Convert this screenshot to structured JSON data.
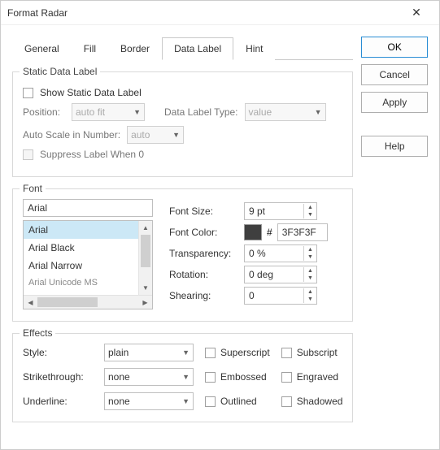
{
  "window": {
    "title": "Format Radar"
  },
  "tabs": [
    "General",
    "Fill",
    "Border",
    "Data Label",
    "Hint"
  ],
  "active_tab": "Data Label",
  "buttons": {
    "ok": "OK",
    "cancel": "Cancel",
    "apply": "Apply",
    "help": "Help"
  },
  "static_label": {
    "legend": "Static Data Label",
    "show": "Show Static Data Label",
    "position_label": "Position:",
    "position_value": "auto fit",
    "type_label": "Data Label Type:",
    "type_value": "value",
    "auto_scale_label": "Auto Scale in Number:",
    "auto_scale_value": "auto",
    "suppress": "Suppress Label When 0"
  },
  "font": {
    "legend": "Font",
    "name": "Arial",
    "list": [
      "Arial",
      "Arial Black",
      "Arial Narrow",
      "Arial Unicode MS"
    ],
    "size_label": "Font Size:",
    "size_value": "9 pt",
    "color_label": "Font Color:",
    "color_prefix": "#",
    "color_value": "3F3F3F",
    "transparency_label": "Transparency:",
    "transparency_value": "0 %",
    "rotation_label": "Rotation:",
    "rotation_value": "0 deg",
    "shearing_label": "Shearing:",
    "shearing_value": "0"
  },
  "effects": {
    "legend": "Effects",
    "style_label": "Style:",
    "style_value": "plain",
    "strike_label": "Strikethrough:",
    "strike_value": "none",
    "underline_label": "Underline:",
    "underline_value": "none",
    "superscript": "Superscript",
    "subscript": "Subscript",
    "embossed": "Embossed",
    "engraved": "Engraved",
    "outlined": "Outlined",
    "shadowed": "Shadowed"
  }
}
